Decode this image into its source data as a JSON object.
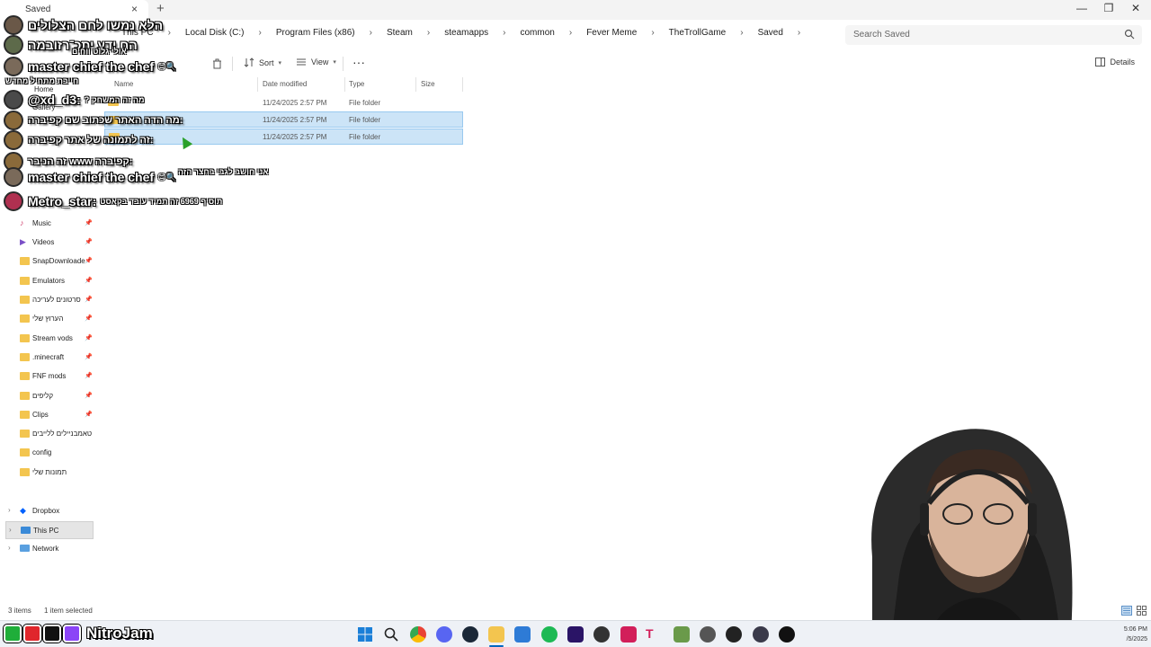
{
  "window": {
    "tab_title": "Saved",
    "tab_close": "×",
    "new_tab": "+",
    "minimize": "—",
    "maximize": "❐",
    "close": "✕"
  },
  "breadcrumbs": [
    "This PC",
    "Local Disk (C:)",
    "Program Files (x86)",
    "Steam",
    "steamapps",
    "common",
    "Fever Meme",
    "TheTrollGame",
    "Saved"
  ],
  "search": {
    "placeholder": "Search Saved"
  },
  "toolbar": {
    "sort_label": "Sort",
    "view_label": "View",
    "more_label": "···",
    "details_label": "Details"
  },
  "columns": {
    "name": "Name",
    "date": "Date modified",
    "type": "Type",
    "size": "Size"
  },
  "files": [
    {
      "date": "11/24/2025 2:57 PM",
      "type": "File folder",
      "selected": false
    },
    {
      "date": "11/24/2025 2:57 PM",
      "type": "File folder",
      "selected": true
    },
    {
      "date": "11/24/2025 2:57 PM",
      "type": "File folder",
      "selected": true
    }
  ],
  "sidebar": {
    "home": "Home",
    "gallery": "Gallery",
    "pinned": [
      "Music",
      "Videos",
      "SnapDownloade",
      "Emulators",
      "סרטונים לעריכה",
      "הערוץ שלי",
      "Stream vods",
      ".minecraft",
      "FNF mods",
      "קליפים",
      "Clips",
      "טאמבניילים ללייבים",
      "config",
      "תמונות שלי"
    ],
    "locations": [
      "Dropbox",
      "This PC",
      "Network"
    ],
    "pin_glyph": "📌",
    "chevron_glyph": "›"
  },
  "status": {
    "count": "3 items",
    "selected": "1 item selected"
  },
  "chat": [
    {
      "user": "הלא נמשו לחם הצלולים",
      "msg": ""
    },
    {
      "user": "הם ידע יתכ־רזובמה",
      "msg": ""
    },
    {
      "user": "master chief the chef",
      "msg": "😊🔍"
    },
    {
      "user": "@xd_d3:",
      "msg": "? מה זה המשחק"
    },
    {
      "user": "מה הדה האתר שכתוב שם קפיברה:",
      "msg": ""
    },
    {
      "user": "זה לתמונה של אתר קפיברה:",
      "msg": ""
    },
    {
      "user": "זה הניבר www קפיברה:",
      "msg": ""
    },
    {
      "user": "master chief the chef",
      "msg": "😊🔍"
    },
    {
      "user": "Metro_star:",
      "msg": "תוסיף 6969 זה תמיד עובד בקאסט"
    }
  ],
  "chat_subs": [
    "אני חושב לגבי בחצר הזה",
    "אולי גלוט ווחים",
    "חייבת מתחיל מחדש"
  ],
  "taskbar": {
    "brand": "NitroJam",
    "time": "5:06 PM",
    "date": "/5/2025"
  },
  "colors": {
    "selection": "#cce4f7",
    "selection_border": "#99c9ef",
    "folder": "#f3c54f",
    "accent": "#0067c0"
  }
}
